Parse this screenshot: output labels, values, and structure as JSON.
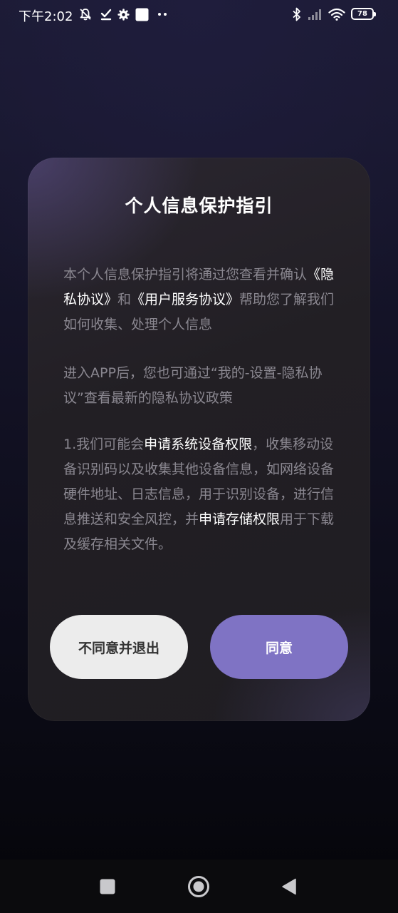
{
  "status_bar": {
    "time": "下午2:02",
    "battery": "78",
    "icons": [
      "mute-bell-icon",
      "checkbox-done-icon",
      "gear-icon",
      "square-notification-icon",
      "more-dots-icon",
      "bluetooth-icon",
      "signal-icon",
      "wifi-icon",
      "battery-icon"
    ]
  },
  "dialog": {
    "title": "个人信息保护指引",
    "paragraph1": {
      "a": "本个人信息保护指引将通过您查看并确认",
      "link1": "《隐私协议》",
      "b": "和",
      "link2": "《用户服务协议》",
      "c": "帮助您了解我们如何收集、处理个人信息"
    },
    "paragraph2": "进入APP后，您也可通过“我的-设置-隐私协议”查看最新的隐私协议政策",
    "paragraph3": {
      "a": "1.我们可能会",
      "hl1": "申请系统设备权限",
      "b": "，收集移动设备识别码以及收集其他设备信息，如网络设备硬件地址、日志信息，用于识别设备，进行信息推送和安全风控，并",
      "hl2": "申请存储权限",
      "c": "用于下载及缓存相关文件。"
    },
    "decline_label": "不同意并退出",
    "agree_label": "同意"
  },
  "colors": {
    "accent": "#7f73c4",
    "decline_bg": "#ececec",
    "body_text": "#8a8790",
    "highlight_text": "#ffffff"
  },
  "nav_bar": {
    "icons": [
      "recents-square-icon",
      "home-circle-icon",
      "back-triangle-icon"
    ]
  }
}
